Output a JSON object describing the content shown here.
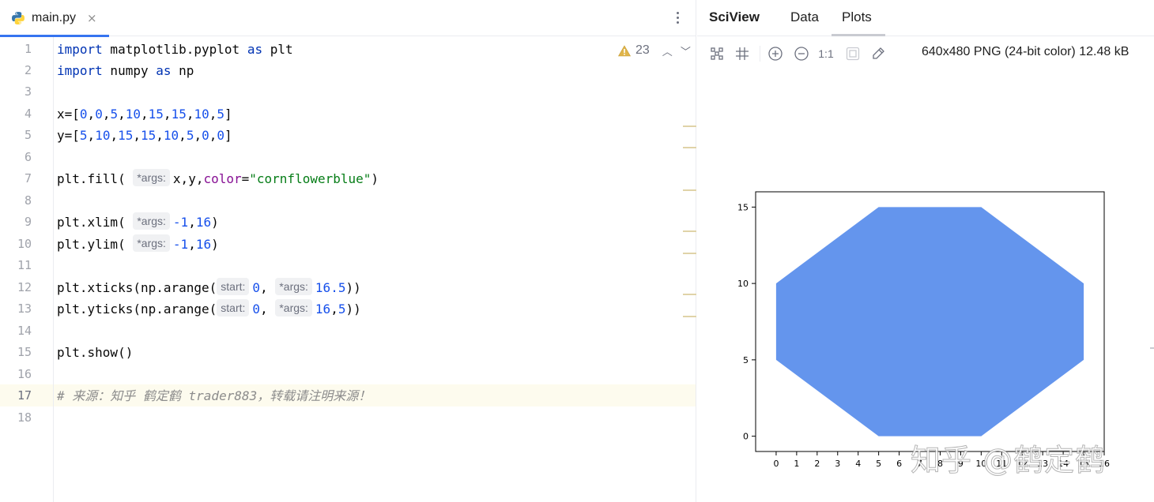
{
  "editor": {
    "tab": {
      "label": "main.py",
      "icon": "python-file-icon",
      "close": "×"
    },
    "inspection": {
      "count": "23"
    },
    "line_numbers": [
      "1",
      "2",
      "3",
      "4",
      "5",
      "6",
      "7",
      "8",
      "9",
      "10",
      "11",
      "12",
      "13",
      "14",
      "15",
      "16",
      "17",
      "18"
    ],
    "lines": {
      "l1": {
        "kw1": "import",
        "mod": " matplotlib.pyplot ",
        "kw2": "as",
        "alias": " plt"
      },
      "l2": {
        "kw1": "import",
        "mod": " numpy ",
        "kw2": "as",
        "alias": " np"
      },
      "l4": {
        "prefix": "x=[",
        "vals": [
          "0",
          "0",
          "5",
          "10",
          "15",
          "15",
          "10",
          "5"
        ],
        "suffix": "]"
      },
      "l5": {
        "prefix": "y=[",
        "vals": [
          "5",
          "10",
          "15",
          "15",
          "10",
          "5",
          "0",
          "0"
        ],
        "suffix": "]"
      },
      "l7": {
        "call": "plt.fill(",
        "hint": "*args:",
        "args": "x,y,",
        "param": "color",
        "eq": "=",
        "str": "\"cornflowerblue\"",
        "close": ")"
      },
      "l9": {
        "call": "plt.xlim(",
        "hint": "*args:",
        "a": "-1",
        "comma": ",",
        "b": "16",
        "close": ")"
      },
      "l10": {
        "call": "plt.ylim(",
        "hint": "*args:",
        "a": "-1",
        "comma": ",",
        "b": "16",
        "close": ")"
      },
      "l12": {
        "call": "plt.xticks(np.arange(",
        "hint1": "start:",
        "a": "0",
        "comma": ",",
        "hint2": "*args:",
        "b": "16.5",
        "close": "))"
      },
      "l13": {
        "call": "plt.yticks(np.arange(",
        "hint1": "start:",
        "a": "0",
        "comma": ",",
        "hint2": "*args:",
        "b": "16",
        "c": "5",
        "close": "))"
      },
      "l15": {
        "text": "plt.show()"
      },
      "l17": {
        "comment": "# 来源：知乎 鹤定鹤 trader883，转载请注明来源！"
      }
    }
  },
  "sciview": {
    "title": "SciView",
    "tabs": [
      "Data",
      "Plots"
    ],
    "active_tab": "Plots",
    "toolbar": {
      "buttons": [
        "grid-icon",
        "crop-icon",
        "zoom-in-icon",
        "zoom-out-icon",
        "actual-size-icon",
        "fit-icon",
        "color-picker-icon"
      ],
      "actual_size_label": "1:1"
    },
    "image_info": "640x480 PNG (24-bit color) 12.48 kB"
  },
  "chart_data": {
    "type": "area",
    "x": [
      0,
      0,
      5,
      10,
      15,
      15,
      10,
      5
    ],
    "y": [
      5,
      10,
      15,
      15,
      10,
      5,
      0,
      0
    ],
    "fill_color": "#6495ed",
    "xlim": [
      -1,
      16
    ],
    "ylim": [
      -1,
      16
    ],
    "xticks": [
      "0",
      "1",
      "2",
      "3",
      "4",
      "5",
      "6",
      "7",
      "8",
      "9",
      "10",
      "11",
      "12",
      "13",
      "14",
      "15",
      "16"
    ],
    "yticks": [
      "0",
      "5",
      "10",
      "15"
    ],
    "title": "",
    "xlabel": "",
    "ylabel": ""
  },
  "watermark": "知乎 @鹤定鹤"
}
